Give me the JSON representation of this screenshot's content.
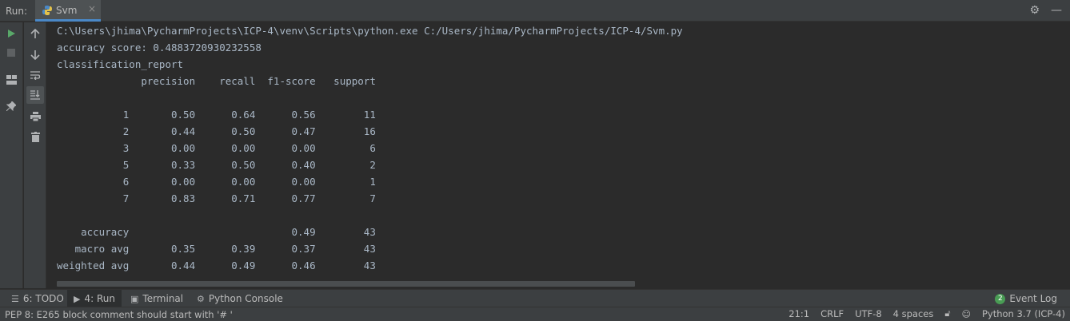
{
  "header": {
    "run_label": "Run:",
    "tab_name": "Svm",
    "tab_close": "×",
    "tab_icon": "python-icon"
  },
  "console": {
    "lines": [
      "C:\\Users\\jhima\\PycharmProjects\\ICP-4\\venv\\Scripts\\python.exe C:/Users/jhima/PycharmProjects/ICP-4/Svm.py",
      "accuracy score: 0.4883720930232558",
      "classification_report",
      "              precision    recall  f1-score   support",
      "",
      "           1       0.50      0.64      0.56        11",
      "           2       0.44      0.50      0.47        16",
      "           3       0.00      0.00      0.00         6",
      "           5       0.33      0.50      0.40         2",
      "           6       0.00      0.00      0.00         1",
      "           7       0.83      0.71      0.77         7",
      "",
      "    accuracy                           0.49        43",
      "   macro avg       0.35      0.39      0.37        43",
      "weighted avg       0.44      0.49      0.46        43"
    ]
  },
  "bottom_tabs": {
    "todo": "6: TODO",
    "run": "4: Run",
    "terminal": "Terminal",
    "python_console": "Python Console",
    "event_log": "Event Log",
    "event_count": "2"
  },
  "status": {
    "message": "PEP 8: E265 block comment should start with '# '",
    "position": "21:1",
    "line_sep": "CRLF",
    "encoding": "UTF-8",
    "indent": "4 spaces",
    "interpreter": "Python 3.7 (ICP-4)"
  },
  "colors": {
    "accent": "#4a88c7",
    "run_green": "#499c54",
    "console_text": "#a9b7c6",
    "background": "#2b2b2b"
  }
}
